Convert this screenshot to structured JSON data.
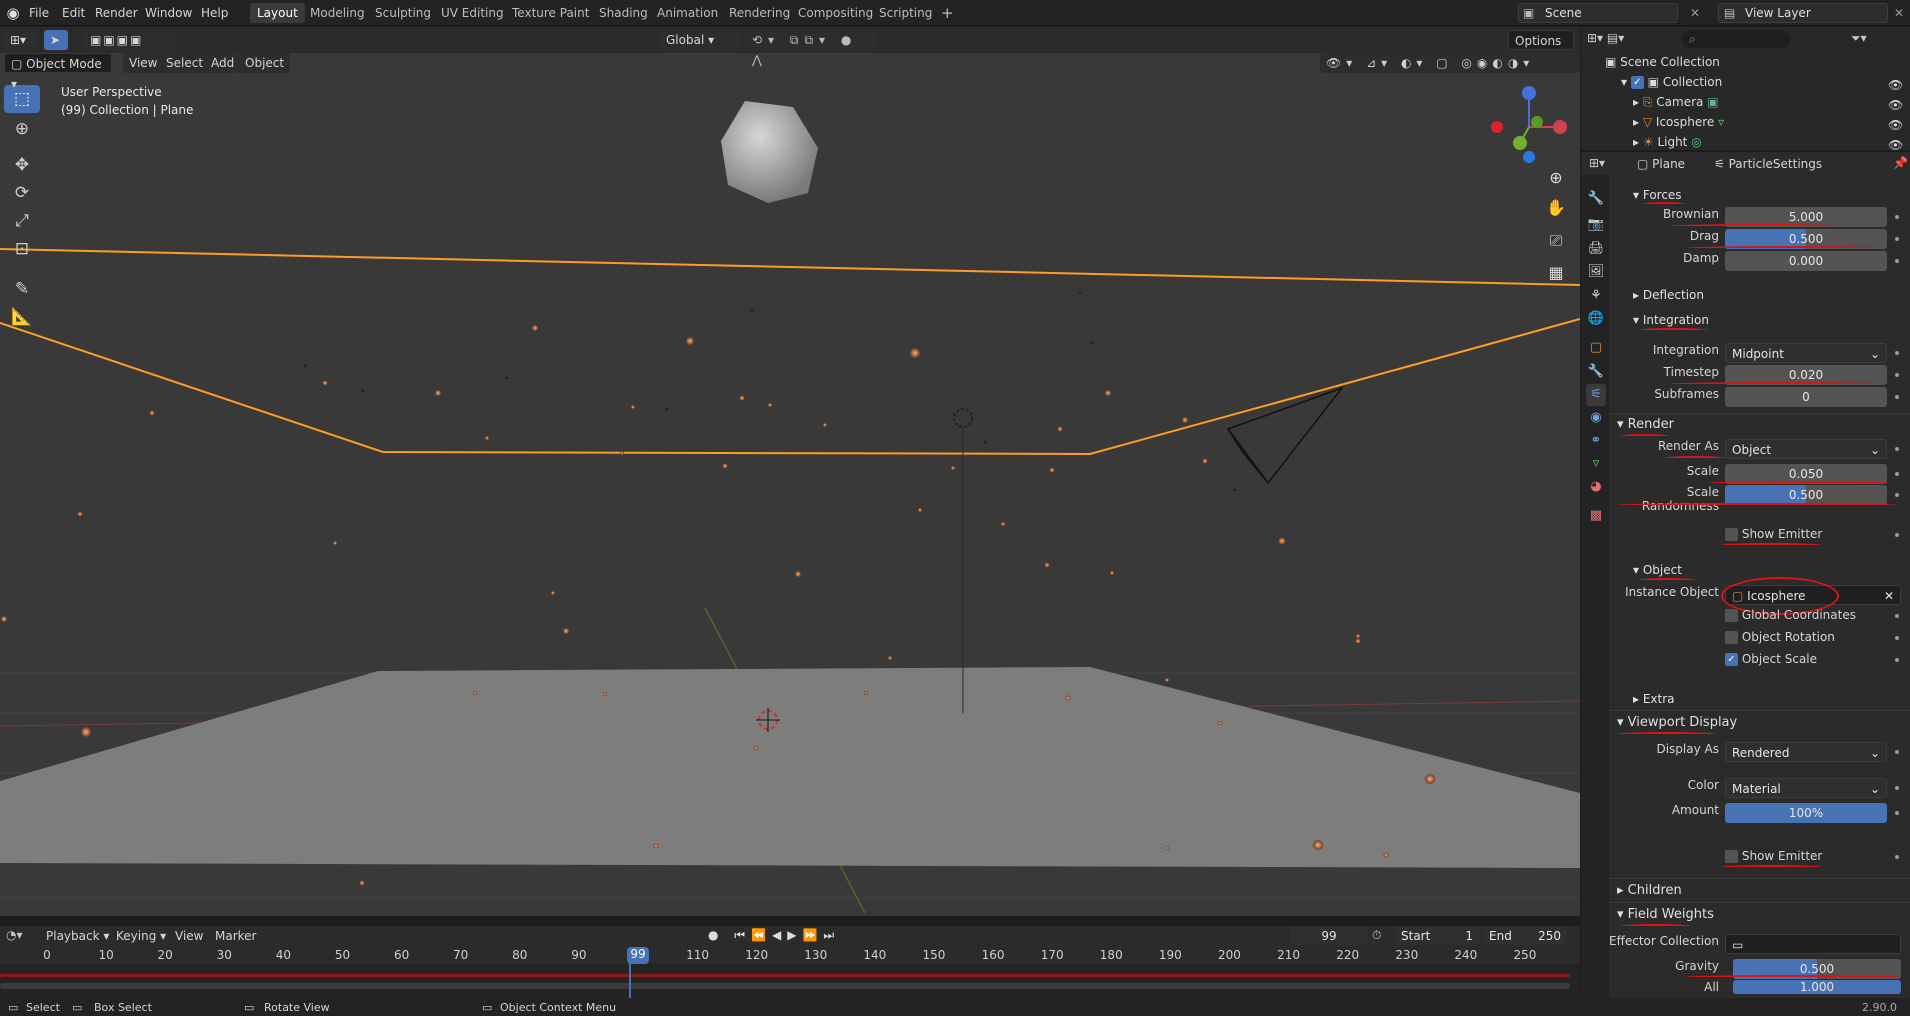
{
  "topbar": {
    "menus": [
      "File",
      "Edit",
      "Render",
      "Window",
      "Help"
    ],
    "workspaces": [
      "Layout",
      "Modeling",
      "Sculpting",
      "UV Editing",
      "Texture Paint",
      "Shading",
      "Animation",
      "Rendering",
      "Compositing",
      "Scripting"
    ],
    "active_workspace": "Layout",
    "scene": "Scene",
    "view_layer": "View Layer"
  },
  "viewport_header": {
    "mode": "Object Mode",
    "menus": [
      "View",
      "Select",
      "Add",
      "Object"
    ],
    "orientation": "Global",
    "options": "Options"
  },
  "viewport": {
    "perspective": "User Perspective",
    "collection_info": "(99) Collection | Plane",
    "accent_color": "#ff9c2a"
  },
  "outliner": {
    "root": "Scene Collection",
    "collection": "Collection",
    "items": [
      "Camera",
      "Icosphere",
      "Light"
    ]
  },
  "properties": {
    "object_name": "Plane",
    "settings_name": "ParticleSettings",
    "forces": {
      "title": "Forces",
      "brownian_label": "Brownian",
      "brownian": "5.000",
      "drag_label": "Drag",
      "drag": "0.500",
      "damp_label": "Damp",
      "damp": "0.000"
    },
    "deflection": "Deflection",
    "integration": {
      "title": "Integration",
      "integration_label": "Integration",
      "integration": "Midpoint",
      "timestep_label": "Timestep",
      "timestep": "0.020",
      "subframes_label": "Subframes",
      "subframes": "0"
    },
    "render": {
      "title": "Render",
      "render_as_label": "Render As",
      "render_as": "Object",
      "scale_label": "Scale",
      "scale": "0.050",
      "scale_randomness_label": "Scale Randomness",
      "scale_randomness": "0.500",
      "show_emitter": "Show Emitter"
    },
    "object": {
      "title": "Object",
      "instance_object_label": "Instance Object",
      "instance_object": "Icosphere",
      "global_coordinates": "Global Coordinates",
      "object_rotation": "Object Rotation",
      "object_scale": "Object Scale"
    },
    "extra": "Extra",
    "viewport_display": {
      "title": "Viewport Display",
      "display_as_label": "Display As",
      "display_as": "Rendered",
      "color_label": "Color",
      "color": "Material",
      "amount_label": "Amount",
      "amount": "100%",
      "show_emitter": "Show Emitter"
    },
    "children": "Children",
    "field_weights": {
      "title": "Field Weights",
      "effector_collection_label": "Effector Collection",
      "gravity_label": "Gravity",
      "gravity": "0.500",
      "all_label": "All",
      "all": "1.000"
    }
  },
  "timeline": {
    "menus": [
      "Playback",
      "Keying",
      "View",
      "Marker"
    ],
    "current_frame": "99",
    "start_label": "Start",
    "start": "1",
    "end_label": "End",
    "end": "250",
    "ticks": [
      "0",
      "10",
      "20",
      "30",
      "40",
      "50",
      "60",
      "70",
      "80",
      "90",
      "99",
      "110",
      "120",
      "130",
      "140",
      "150",
      "160",
      "170",
      "180",
      "190",
      "200",
      "210",
      "220",
      "230",
      "240",
      "250"
    ]
  },
  "statusbar": {
    "select": "Select",
    "box_select": "Box Select",
    "rotate_view": "Rotate View",
    "context_menu": "Object Context Menu",
    "version": "2.90.0"
  },
  "icons": [
    "blender-logo",
    "select-box-icon",
    "cursor-icon",
    "move-icon",
    "rotate-icon",
    "scale-icon",
    "transform-icon",
    "annotate-icon",
    "measure-icon",
    "eye-icon",
    "camera-icon",
    "light-icon",
    "mesh-icon",
    "zoom-icon",
    "hand-icon",
    "grid-icon"
  ]
}
